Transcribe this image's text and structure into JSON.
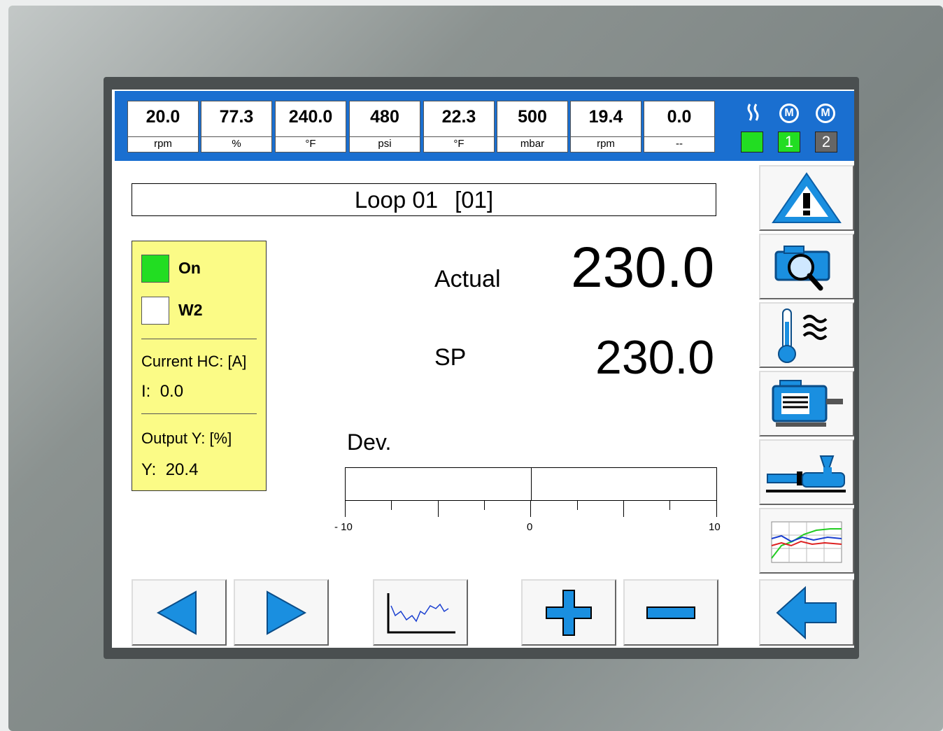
{
  "topbar": {
    "tiles": [
      {
        "value": "20.0",
        "unit": "rpm"
      },
      {
        "value": "77.3",
        "unit": "%"
      },
      {
        "value": "240.0",
        "unit": "°F"
      },
      {
        "value": "480",
        "unit": "psi"
      },
      {
        "value": "22.3",
        "unit": "°F"
      },
      {
        "value": "500",
        "unit": "mbar"
      },
      {
        "value": "19.4",
        "unit": "rpm"
      },
      {
        "value": "0.0",
        "unit": "--"
      }
    ],
    "status": {
      "heating_icon": "heating-wave-icon",
      "motor_icon_label": "M",
      "motor1_number": "1",
      "motor2_number": "2",
      "heating_color": "#22dd22",
      "motor1_color": "#22dd22",
      "motor2_color": "#666666"
    }
  },
  "loop": {
    "name": "Loop 01",
    "id": "[01]"
  },
  "panel": {
    "on_label": "On",
    "on_color": "#22dd22",
    "w2_label": "W2",
    "current_label": "Current HC: [A]",
    "current_prefix": "I:",
    "current_value": "0.0",
    "output_label": "Output Y: [%]",
    "output_prefix": "Y:",
    "output_value": "20.4"
  },
  "values": {
    "actual_label": "Actual",
    "actual_value": "230.0",
    "sp_label": "SP",
    "sp_value": "230.0"
  },
  "deviation": {
    "label": "Dev.",
    "min_label": "- 10",
    "mid_label": "0",
    "max_label": "10",
    "value": 0.0
  },
  "side_buttons": [
    "alarm-warning-icon",
    "zoom-camera-icon",
    "temperature-icon",
    "motor-icon",
    "extruder-icon",
    "trend-chart-icon",
    "back-arrow-icon"
  ],
  "bottom_buttons": [
    "prev-arrow-icon",
    "next-arrow-icon",
    "trend-icon",
    "plus-icon",
    "minus-icon"
  ],
  "colors": {
    "accent": "#1a6fd0",
    "panel": "#fbfb86"
  }
}
